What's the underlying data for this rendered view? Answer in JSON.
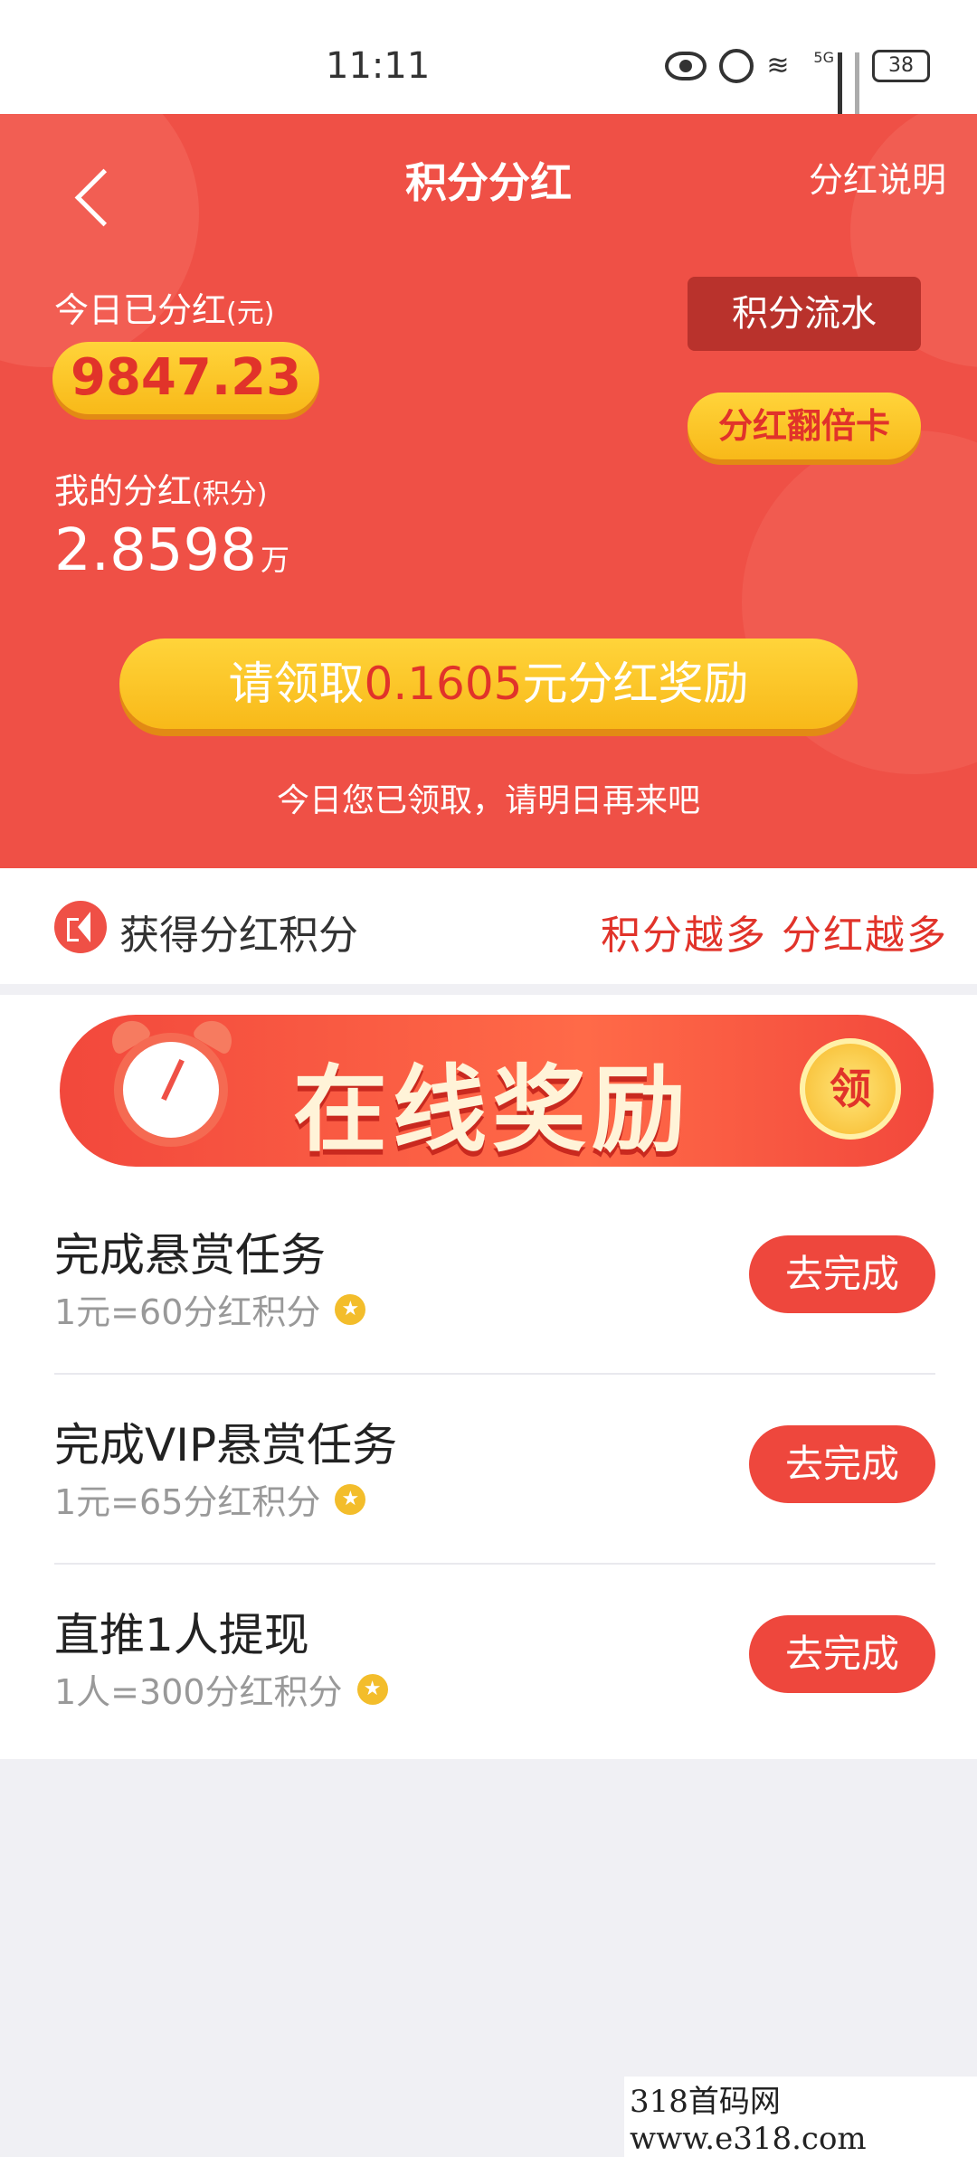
{
  "status_bar": {
    "time": "11:11",
    "signal_label": "5G",
    "battery": "38"
  },
  "header": {
    "title": "积分分红",
    "explain_link": "分红说明"
  },
  "summary": {
    "today_label": "今日已分红",
    "today_unit": "(元)",
    "today_value": "9847.23",
    "flow_button": "积分流水",
    "double_card_button": "分红翻倍卡",
    "my_label": "我的分红",
    "my_unit": "(积分)",
    "my_value": "2.8598",
    "my_value_unit": "万",
    "claim_prefix": "请领取",
    "claim_amount": "0.1605",
    "claim_suffix": "元分红奖励",
    "claimed_note": "今日您已领取，请明日再来吧"
  },
  "notice": {
    "label": "获得分红积分",
    "slogan": "积分越多 分红越多"
  },
  "banner": {
    "text": "在线奖励",
    "coin_label": "领"
  },
  "tasks": [
    {
      "name": "完成悬赏任务",
      "rate": "1元=60分红积分",
      "button": "去完成"
    },
    {
      "name": "完成VIP悬赏任务",
      "rate": "1元=65分红积分",
      "button": "去完成"
    },
    {
      "name": "直推1人提现",
      "rate": "1人=300分红积分",
      "button": "去完成"
    }
  ],
  "watermark": "318首码网  www.e318.com",
  "colors": {
    "primary_red": "#ef5046",
    "gold": "#f8b919",
    "button_red": "#ee473d"
  }
}
